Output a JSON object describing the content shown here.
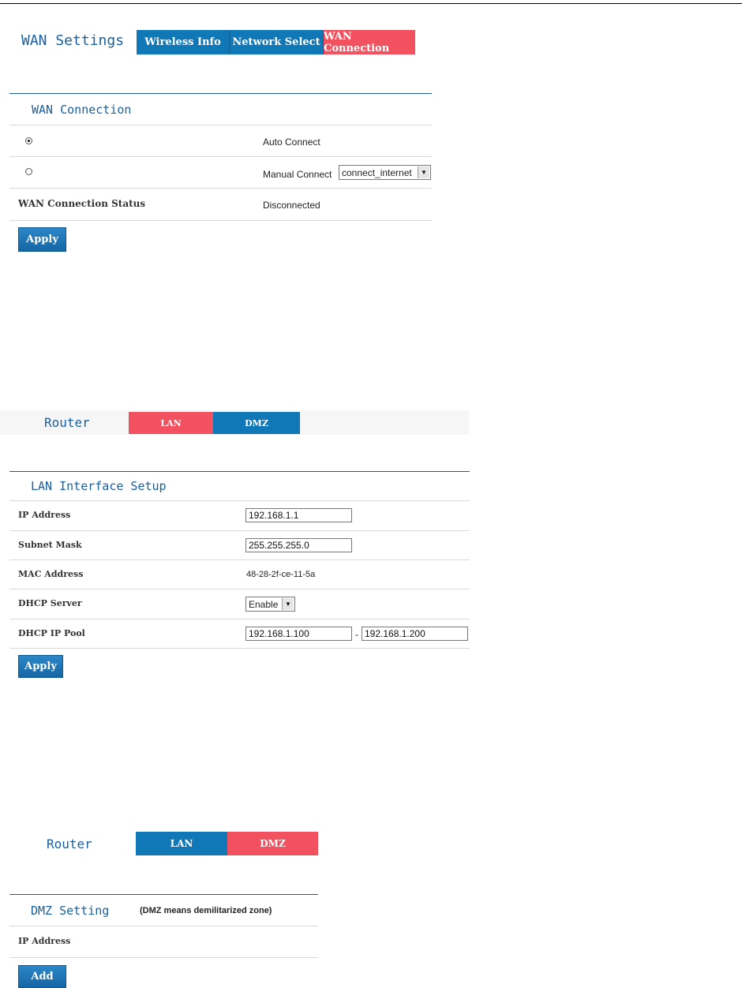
{
  "wan": {
    "page_title": "WAN Settings",
    "tabs": [
      "Wireless Info",
      "Network Select",
      "WAN Connection"
    ],
    "section_title": "WAN Connection",
    "auto_label": "Auto Connect",
    "manual_label": "Manual Connect",
    "manual_select_value": "connect_internet",
    "status_label": "WAN Connection Status",
    "status_value": "Disconnected",
    "apply_label": "Apply"
  },
  "lan": {
    "page_title": "Router",
    "tabs": [
      "LAN",
      "DMZ"
    ],
    "section_title": "LAN Interface Setup",
    "ip_label": "IP Address",
    "ip_value": "192.168.1.1",
    "subnet_label": "Subnet Mask",
    "subnet_value": "255.255.255.0",
    "mac_label": "MAC Address",
    "mac_value": "48-28-2f-ce-11-5a",
    "dhcp_label": "DHCP Server",
    "dhcp_value": "Enable",
    "pool_label": "DHCP IP Pool",
    "pool_start": "192.168.1.100",
    "pool_separator": "-",
    "pool_end": "192.168.1.200",
    "apply_label": "Apply"
  },
  "dmz": {
    "page_title": "Router",
    "tabs": [
      "LAN",
      "DMZ"
    ],
    "section_title": "DMZ Setting",
    "section_note": "(DMZ means demilitarized zone)",
    "ip_label": "IP Address",
    "add_label": "Add"
  },
  "colors": {
    "tab_blue": "#1178b8",
    "tab_active_red": "#f2525f",
    "title_blue": "#1a5fa0"
  }
}
